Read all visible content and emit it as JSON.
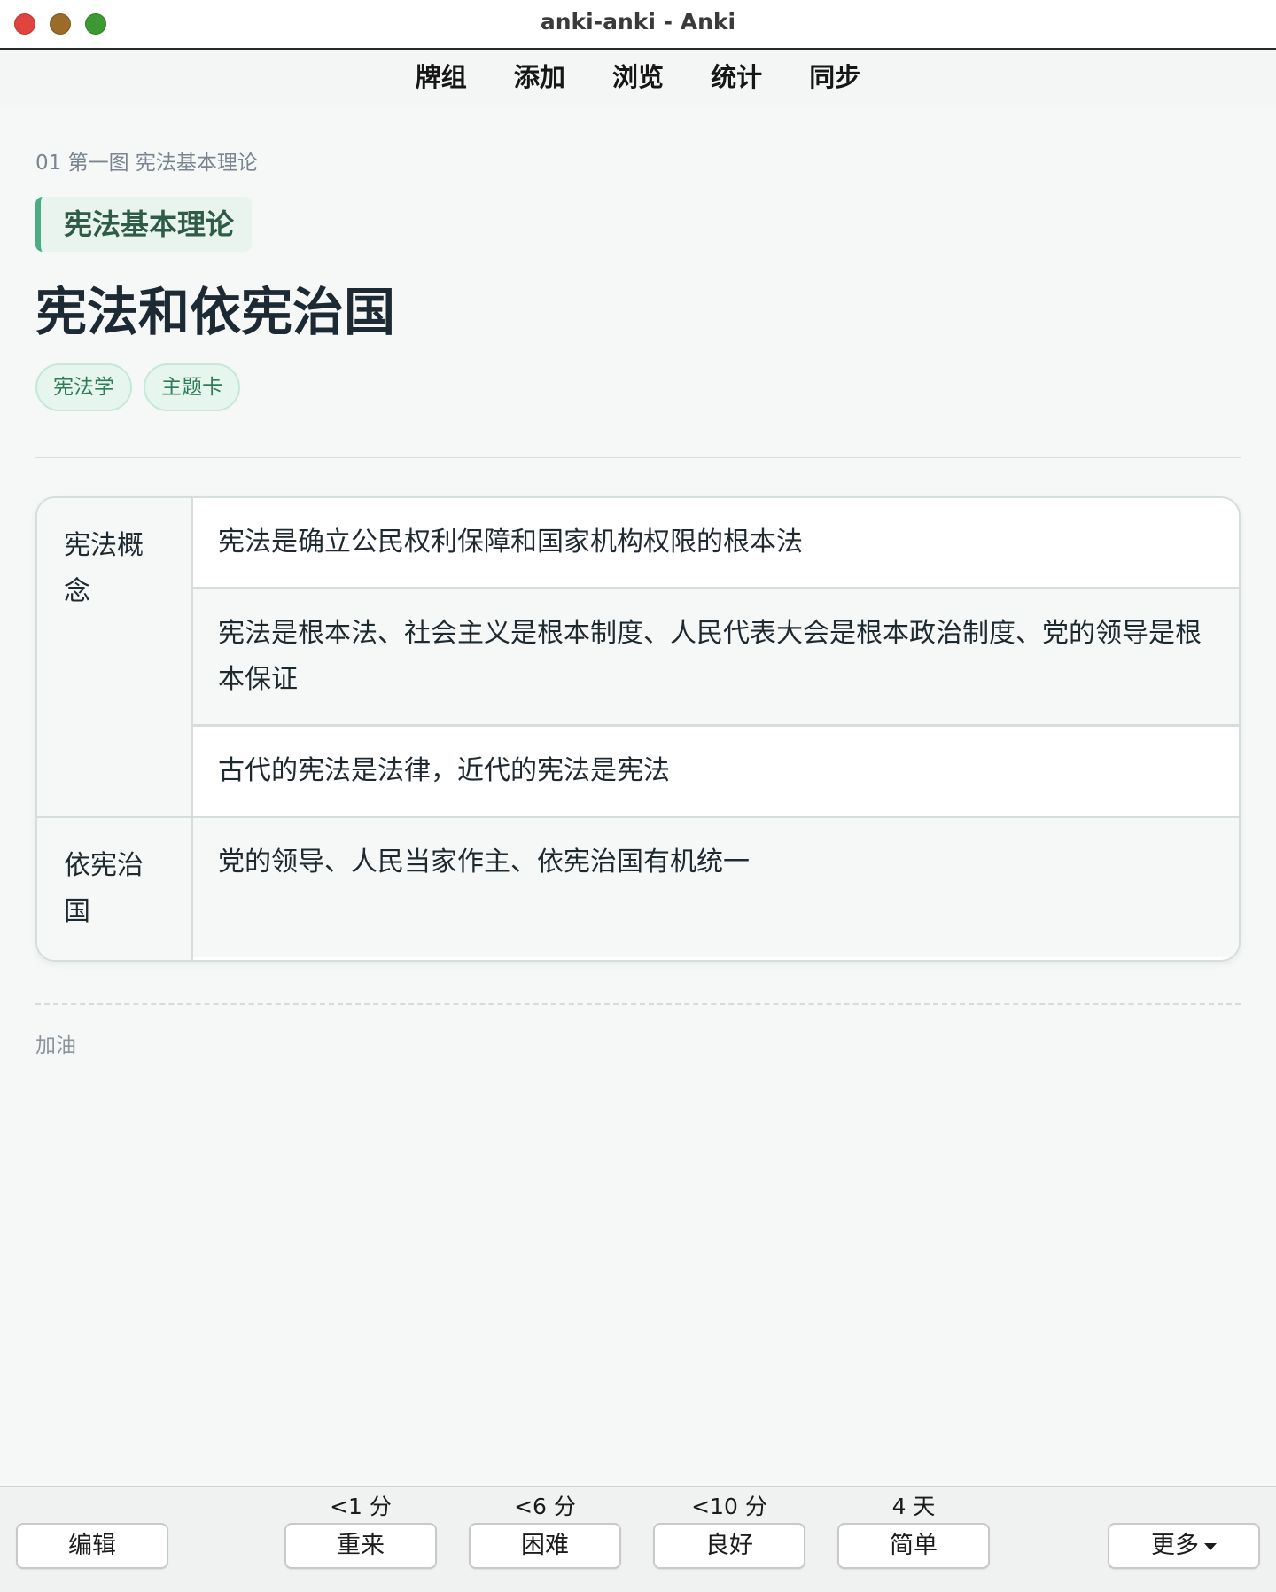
{
  "window": {
    "title": "anki-anki - Anki",
    "traffic_lights": [
      "close",
      "minimize",
      "zoom"
    ]
  },
  "topnav": {
    "items": [
      "牌组",
      "添加",
      "浏览",
      "统计",
      "同步"
    ]
  },
  "card": {
    "deck_path": "01 第一图 宪法基本理论",
    "section": "宪法基本理论",
    "title": "宪法和依宪治国",
    "tags": [
      "宪法学",
      "主题卡"
    ],
    "table": [
      {
        "category": "宪法概念",
        "items": [
          "宪法是确立公民权利保障和国家机构权限的根本法",
          "宪法是根本法、社会主义是根本制度、人民代表大会是根本政治制度、党的领导是根本保证",
          "古代的宪法是法律，近代的宪法是宪法"
        ]
      },
      {
        "category": "依宪治国",
        "items": [
          "党的领导、人民当家作主、依宪治国有机统一"
        ]
      }
    ],
    "footer_note": "加油"
  },
  "bottom": {
    "edit_label": "编辑",
    "more_label": "更多",
    "answers": [
      {
        "interval": "<1 分",
        "label": "重来"
      },
      {
        "interval": "<6 分",
        "label": "困难"
      },
      {
        "interval": "<10 分",
        "label": "良好"
      },
      {
        "interval": "4 天",
        "label": "简单"
      }
    ]
  },
  "colors": {
    "accent_green": "#4bab83",
    "tag_text": "#2f7c58",
    "close": "#e0443e",
    "minimize": "#9b6b29",
    "zoom": "#3d9a32"
  }
}
